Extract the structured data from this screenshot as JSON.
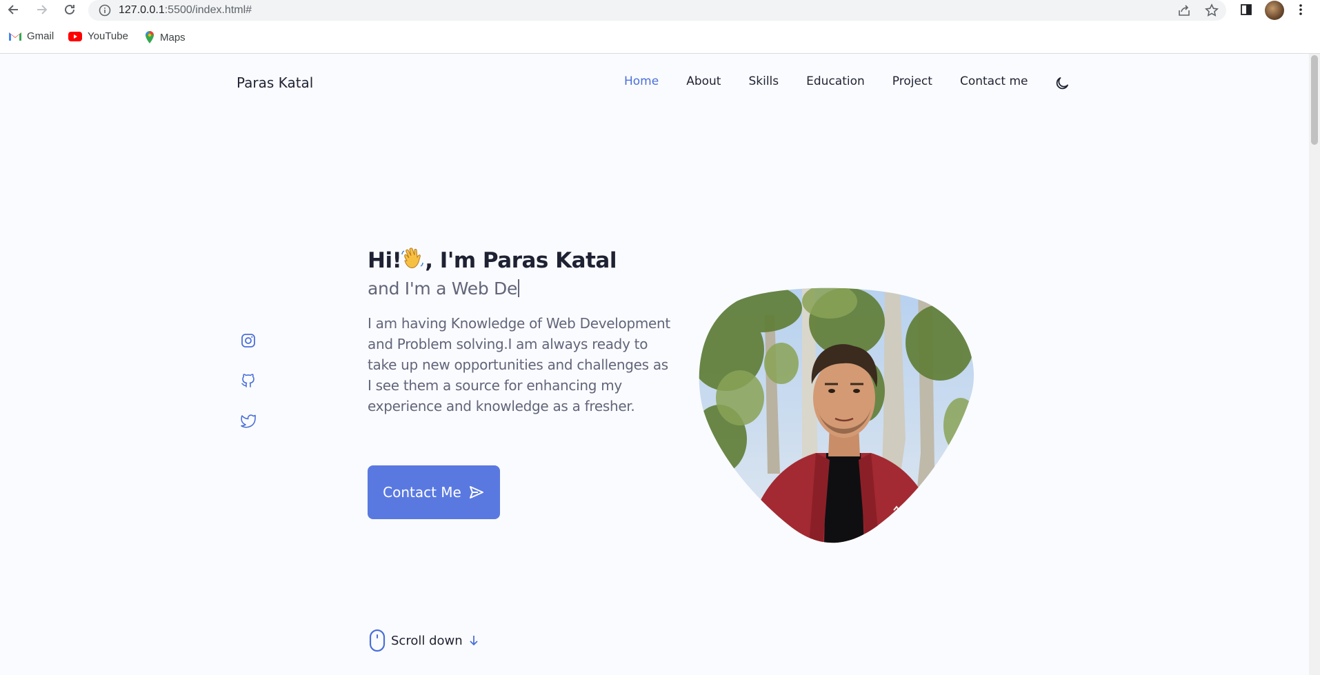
{
  "browser": {
    "url_host": "127.0.0.1",
    "url_rest": ":5500/index.html#",
    "bookmarks": [
      "Gmail",
      "YouTube",
      "Maps"
    ]
  },
  "nav": {
    "logo": "Paras Katal",
    "items": [
      "Home",
      "About",
      "Skills",
      "Education",
      "Project",
      "Contact me"
    ],
    "active": "Home",
    "theme_icon": "moon-icon"
  },
  "socials": [
    "instagram-icon",
    "github-icon",
    "twitter-icon"
  ],
  "hero": {
    "title_before": "Hi!",
    "title_after": ", I'm Paras Katal",
    "subtitle": "and I'm a Web De",
    "description": "I am having Knowledge of Web Development and Problem solving.I am always ready to take up new opportunities and challenges as I see them a source for enhancing my experience and knowledge as a fresher.",
    "button_label": "Contact Me",
    "scroll_label": "Scroll down"
  },
  "colors": {
    "accent": "#5a79e0",
    "nav_active": "#4a6fd8",
    "text_dark": "#1f2233",
    "text_muted": "#62657a",
    "background": "#fafbfe"
  }
}
